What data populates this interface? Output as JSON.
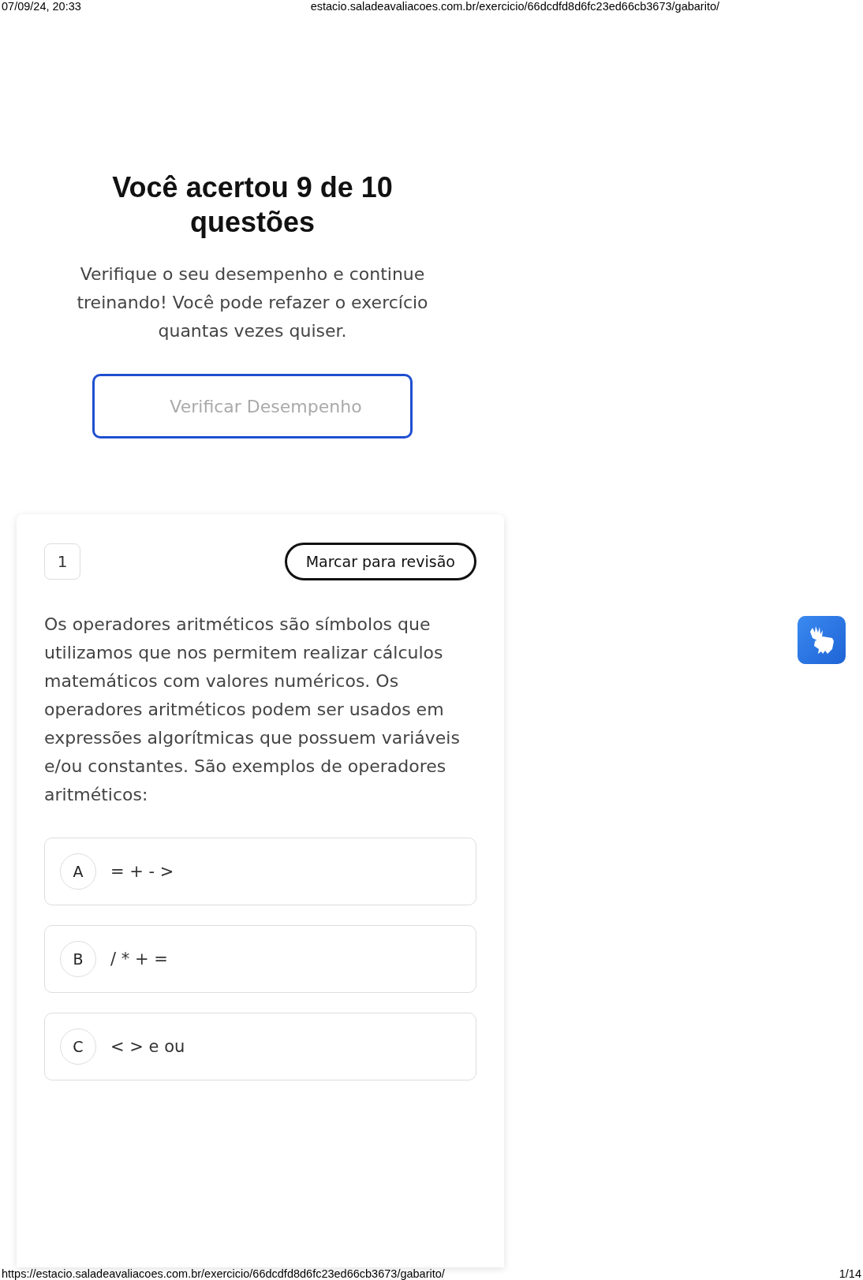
{
  "print_header": {
    "datetime": "07/09/24, 20:33",
    "url": "estacio.saladeavaliacoes.com.br/exercicio/66dcdfd8d6fc23ed66cb3673/gabarito/"
  },
  "result": {
    "title": "Você acertou 9 de 10 questões",
    "subtitle": "Verifique o seu desempenho e continue treinando! Você pode refazer o exercício quantas vezes quiser.",
    "button": "Verificar Desempenho"
  },
  "question": {
    "number": "1",
    "review_button": "Marcar para revisão",
    "text": "Os operadores aritméticos são símbolos que utilizamos que nos permitem realizar cálculos matemáticos com valores numéricos. Os operadores aritméticos podem ser usados em expressões algorítmicas que possuem variáveis e/ou constantes. São exemplos de operadores aritméticos:",
    "options": [
      {
        "letter": "A",
        "text": "= + - >"
      },
      {
        "letter": "B",
        "text": "/ * + ="
      },
      {
        "letter": "C",
        "text": "< > e ou"
      }
    ]
  },
  "print_footer": {
    "url": "https://estacio.saladeavaliacoes.com.br/exercicio/66dcdfd8d6fc23ed66cb3673/gabarito/",
    "page": "1/14"
  }
}
